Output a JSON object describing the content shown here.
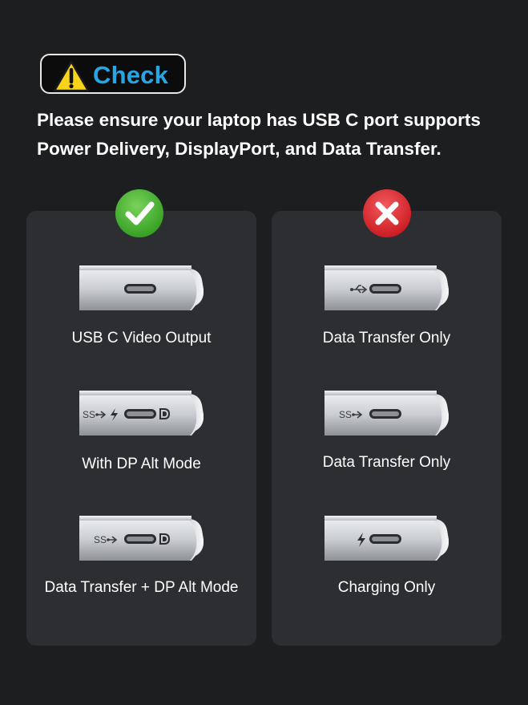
{
  "header": {
    "badge_label": "Check",
    "warning_icon": "warning-triangle-icon"
  },
  "message": {
    "line1": "Please ensure your laptop has  USB C port supports",
    "line2": "Power Delivery, DisplayPort, and Data Transfer."
  },
  "supported": {
    "icon": "green-check-icon",
    "items": [
      {
        "label": "USB C Video Output",
        "port_icons": [
          "usb-c-port"
        ]
      },
      {
        "label": "With DP Alt Mode",
        "port_icons": [
          "ss-usb-symbol",
          "lightning-bolt",
          "usb-c-port",
          "displayport-symbol"
        ]
      },
      {
        "label": "Data Transfer + DP Alt Mode",
        "port_icons": [
          "ss-usb-symbol",
          "usb-c-port",
          "displayport-symbol"
        ]
      }
    ]
  },
  "unsupported": {
    "icon": "red-cross-icon",
    "items": [
      {
        "label": "Data Transfer Only",
        "port_icons": [
          "usb-symbol",
          "usb-c-port"
        ]
      },
      {
        "label": "Data Transfer Only",
        "port_icons": [
          "ss-usb-symbol",
          "usb-c-port"
        ]
      },
      {
        "label": "Charging Only",
        "port_icons": [
          "lightning-bolt",
          "usb-c-port"
        ]
      }
    ]
  },
  "colors": {
    "background": "#1d1e20",
    "panel": "#2d2e31",
    "badge_text": "#27a6e4",
    "warning": "#f7d31a",
    "ok": "#3fae29",
    "error": "#e0252c"
  }
}
